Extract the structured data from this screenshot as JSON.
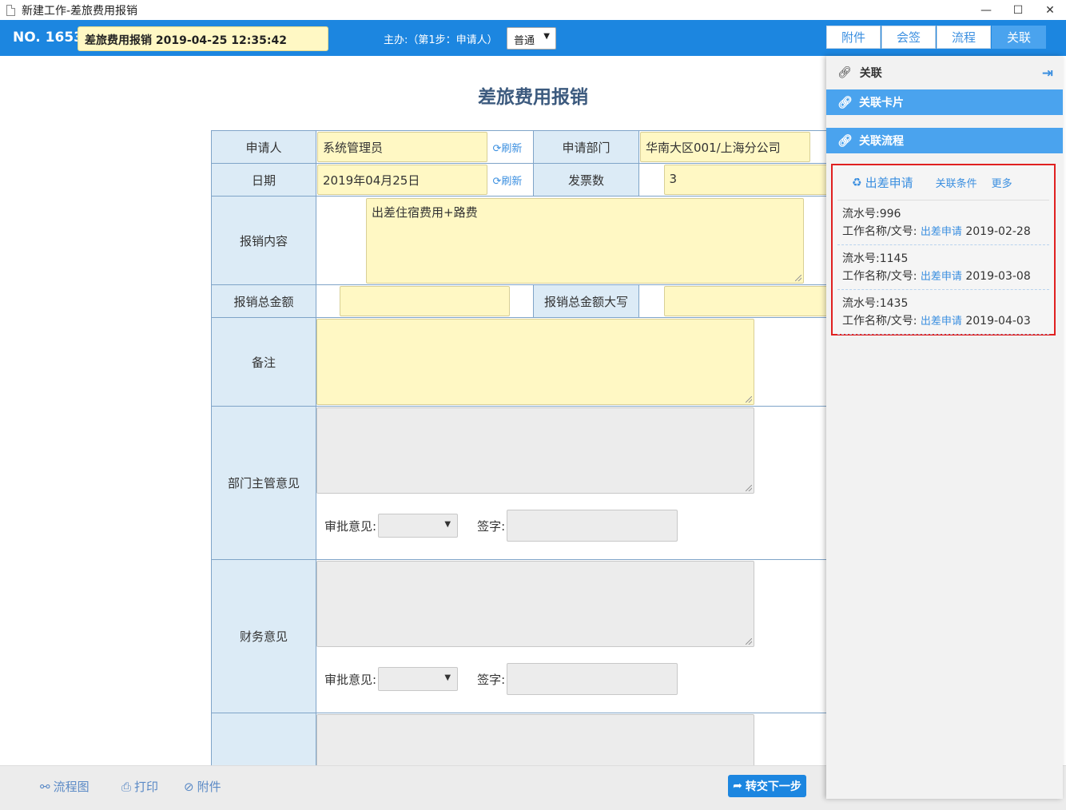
{
  "window": {
    "title": "新建工作-差旅费用报销",
    "minimize": "—",
    "maximize": "☐",
    "close": "✕"
  },
  "header": {
    "no": "NO. 1653",
    "work_title": "差旅费用报销 2019-04-25 12:35:42",
    "step": "主办:（第1步：申请人）",
    "level": "普通",
    "tabs": [
      "附件",
      "会签",
      "流程",
      "关联"
    ]
  },
  "form": {
    "title": "差旅费用报销",
    "refresh": "刷新",
    "applicant_label": "申请人",
    "applicant": "系统管理员",
    "dept_label": "申请部门",
    "dept": "华南大区001/上海分公司",
    "date_label": "日期",
    "date": "2019年04月25日",
    "invoice_label": "发票数",
    "invoice": "3",
    "content_label": "报销内容",
    "content": "出差住宿费用+路费",
    "total_label": "报销总金额",
    "total": "",
    "total_cn_label": "报销总金额大写",
    "total_cn": "",
    "remark_label": "备注",
    "remark": "",
    "dept_mgr_label": "部门主管意见",
    "finance_label": "财务意见",
    "approve_label": "审批意见:",
    "sign_label": "签字:"
  },
  "bottom": {
    "flowchart": "流程图",
    "print": "打印",
    "attach": "附件",
    "next": "转交下一步"
  },
  "panel": {
    "head": "关联",
    "card": "关联卡片",
    "flow": "关联流程",
    "rel_title": "出差申请",
    "rel_cond": "关联条件",
    "rel_more": "更多",
    "items": [
      {
        "no": "流水号:996",
        "name_label": "工作名称/文号:",
        "name": "出差申请",
        "date": "2019-02-28"
      },
      {
        "no": "流水号:1145",
        "name_label": "工作名称/文号:",
        "name": "出差申请",
        "date": "2019-03-08"
      },
      {
        "no": "流水号:1435",
        "name_label": "工作名称/文号:",
        "name": "出差申请",
        "date": "2019-04-03"
      }
    ]
  }
}
